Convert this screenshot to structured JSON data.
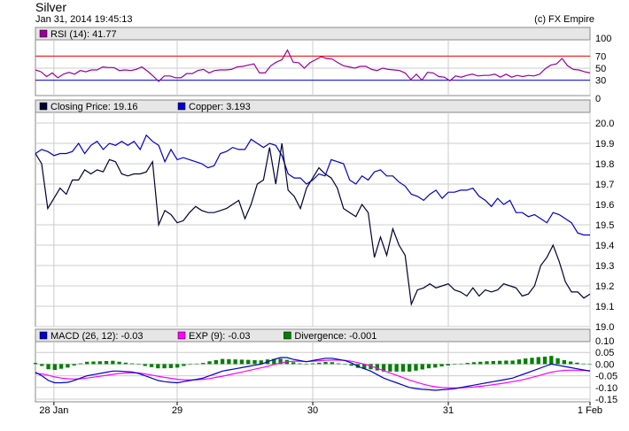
{
  "header": {
    "title": "Silver",
    "timestamp": "Jan 31, 2014 19:45:13",
    "credit": "(c) FX Empire"
  },
  "colors": {
    "rsi": "#990099",
    "closing": "#000033",
    "copper": "#0000cc",
    "macd": "#0000cc",
    "exp": "#ff00ff",
    "divergence": "#008000",
    "rsi_upper": "#ff0000",
    "rsi_lower": "#0000ff",
    "panel_header": "#e6e6e6",
    "grid": "#cccccc"
  },
  "chart_data": [
    {
      "type": "line",
      "panel": "rsi",
      "legend": [
        {
          "label": "RSI (14): 41.77",
          "color": "#990099"
        }
      ],
      "ylim": [
        0,
        100
      ],
      "yticks": [
        "100",
        "70",
        "50",
        "30",
        "0"
      ],
      "ytick_values": [
        100,
        70,
        50,
        30,
        0
      ],
      "reference_lines": [
        70,
        30
      ],
      "series": [
        {
          "values": [
            47,
            44,
            36,
            42,
            34,
            40,
            43,
            40,
            46,
            44,
            47,
            47,
            52,
            51,
            51,
            46,
            47,
            46,
            48,
            52,
            45,
            37,
            28,
            37,
            37,
            34,
            34,
            41,
            41,
            46,
            48,
            42,
            46,
            47,
            47,
            48,
            52,
            53,
            55,
            57,
            42,
            42,
            54,
            60,
            64,
            80,
            60,
            59,
            50,
            59,
            64,
            69,
            66,
            65,
            59,
            54,
            52,
            50,
            53,
            53,
            48,
            46,
            50,
            48,
            47,
            46,
            42,
            31,
            40,
            30,
            43,
            42,
            36,
            35,
            29,
            37,
            35,
            38,
            40,
            37,
            38,
            38,
            40,
            35,
            40,
            35,
            38,
            36,
            38,
            37,
            40,
            49,
            55,
            57,
            66,
            54,
            48,
            47,
            44,
            42
          ]
        }
      ]
    },
    {
      "type": "line",
      "panel": "price",
      "legend": [
        {
          "label": "Closing Price: 19.16",
          "color": "#000033"
        },
        {
          "label": "Copper: 3.193",
          "color": "#0000cc"
        }
      ],
      "ylim": [
        19.0,
        20.0
      ],
      "yticks": [
        "20.0",
        "19.9",
        "19.8",
        "19.7",
        "19.6",
        "19.5",
        "19.4",
        "19.3",
        "19.2",
        "19.1",
        "19.0"
      ],
      "ytick_values": [
        20.0,
        19.9,
        19.8,
        19.7,
        19.6,
        19.5,
        19.4,
        19.3,
        19.2,
        19.1,
        19.0
      ],
      "series": [
        {
          "name": "Closing Price",
          "values": [
            19.85,
            19.8,
            19.58,
            19.63,
            19.68,
            19.65,
            19.72,
            19.72,
            19.77,
            19.75,
            19.77,
            19.76,
            19.82,
            19.81,
            19.75,
            19.74,
            19.75,
            19.75,
            19.76,
            19.81,
            19.5,
            19.57,
            19.55,
            19.51,
            19.52,
            19.56,
            19.59,
            19.57,
            19.56,
            19.56,
            19.57,
            19.58,
            19.6,
            19.62,
            19.53,
            19.6,
            19.7,
            19.72,
            19.88,
            19.7,
            19.9,
            19.67,
            19.64,
            19.58,
            19.68,
            19.73,
            19.78,
            19.75,
            19.73,
            19.68,
            19.58,
            19.56,
            19.54,
            19.6,
            19.56,
            19.34,
            19.44,
            19.35,
            19.48,
            19.4,
            19.35,
            19.11,
            19.18,
            19.19,
            19.21,
            19.19,
            19.2,
            19.21,
            19.18,
            19.17,
            19.15,
            19.19,
            19.15,
            19.18,
            19.17,
            19.18,
            19.21,
            19.2,
            19.19,
            19.15,
            19.16,
            19.2,
            19.3,
            19.34,
            19.4,
            19.32,
            19.22,
            19.17,
            19.17,
            19.14,
            19.16
          ]
        },
        {
          "name": "Copper",
          "values": [
            19.85,
            19.87,
            19.86,
            19.84,
            19.85,
            19.85,
            19.86,
            19.9,
            19.85,
            19.89,
            19.91,
            19.87,
            19.9,
            19.89,
            19.91,
            19.89,
            19.91,
            19.87,
            19.94,
            19.91,
            19.89,
            19.81,
            19.87,
            19.82,
            19.83,
            19.82,
            19.81,
            19.8,
            19.78,
            19.79,
            19.85,
            19.86,
            19.88,
            19.87,
            19.87,
            19.92,
            19.9,
            19.88,
            19.9,
            19.89,
            19.84,
            19.75,
            19.73,
            19.73,
            19.7,
            19.72,
            19.75,
            19.74,
            19.82,
            19.81,
            19.8,
            19.72,
            19.7,
            19.74,
            19.72,
            19.76,
            19.77,
            19.74,
            19.74,
            19.71,
            19.69,
            19.65,
            19.64,
            19.62,
            19.65,
            19.67,
            19.63,
            19.66,
            19.66,
            19.67,
            19.67,
            19.68,
            19.64,
            19.62,
            19.59,
            19.63,
            19.6,
            19.62,
            19.56,
            19.56,
            19.54,
            19.55,
            19.53,
            19.51,
            19.56,
            19.55,
            19.53,
            19.51,
            19.46,
            19.45,
            19.45
          ]
        }
      ]
    },
    {
      "type": "line",
      "panel": "macd",
      "legend": [
        {
          "label": "MACD (26, 12): -0.03",
          "color": "#0000cc"
        },
        {
          "label": "EXP (9): -0.03",
          "color": "#ff00ff"
        },
        {
          "label": "Divergence: -0.001",
          "color": "#008000"
        }
      ],
      "ylim": [
        -0.15,
        0.1
      ],
      "yticks": [
        "0.10",
        "0.05",
        "0.00",
        "-0.05",
        "-0.10",
        "-0.15"
      ],
      "ytick_values": [
        0.1,
        0.05,
        0.0,
        -0.05,
        -0.1,
        -0.15
      ],
      "x_tick_labels": [
        "28 Jan",
        "29",
        "30",
        "31",
        "1 Feb"
      ],
      "x_tick_index": [
        3,
        23,
        45,
        67,
        90
      ],
      "series": [
        {
          "name": "MACD",
          "values": [
            -0.035,
            -0.05,
            -0.07,
            -0.08,
            -0.08,
            -0.078,
            -0.07,
            -0.06,
            -0.05,
            -0.045,
            -0.04,
            -0.035,
            -0.03,
            -0.03,
            -0.032,
            -0.034,
            -0.04,
            -0.05,
            -0.06,
            -0.07,
            -0.075,
            -0.078,
            -0.08,
            -0.075,
            -0.07,
            -0.065,
            -0.06,
            -0.05,
            -0.04,
            -0.03,
            -0.025,
            -0.02,
            -0.015,
            -0.01,
            -0.005,
            0.0,
            0.01,
            0.02,
            0.028,
            0.028,
            0.02,
            0.015,
            0.01,
            0.015,
            0.02,
            0.025,
            0.025,
            0.02,
            0.015,
            0.005,
            -0.01,
            -0.02,
            -0.03,
            -0.045,
            -0.06,
            -0.07,
            -0.08,
            -0.09,
            -0.1,
            -0.105,
            -0.108,
            -0.11,
            -0.112,
            -0.11,
            -0.108,
            -0.105,
            -0.1,
            -0.095,
            -0.09,
            -0.085,
            -0.08,
            -0.075,
            -0.07,
            -0.065,
            -0.06,
            -0.05,
            -0.04,
            -0.03,
            -0.02,
            -0.01,
            0.0,
            -0.005,
            -0.01,
            -0.015,
            -0.02,
            -0.025,
            -0.03
          ]
        },
        {
          "name": "EXP",
          "values": [
            -0.04,
            -0.042,
            -0.048,
            -0.055,
            -0.06,
            -0.063,
            -0.064,
            -0.063,
            -0.06,
            -0.056,
            -0.052,
            -0.048,
            -0.044,
            -0.04,
            -0.038,
            -0.037,
            -0.038,
            -0.042,
            -0.047,
            -0.052,
            -0.057,
            -0.061,
            -0.065,
            -0.067,
            -0.068,
            -0.067,
            -0.065,
            -0.062,
            -0.057,
            -0.052,
            -0.046,
            -0.04,
            -0.034,
            -0.028,
            -0.022,
            -0.016,
            -0.01,
            -0.002,
            0.005,
            0.01,
            0.012,
            0.012,
            0.011,
            0.012,
            0.014,
            0.016,
            0.017,
            0.017,
            0.016,
            0.012,
            0.006,
            0.0,
            -0.008,
            -0.018,
            -0.028,
            -0.038,
            -0.048,
            -0.058,
            -0.068,
            -0.077,
            -0.085,
            -0.092,
            -0.097,
            -0.1,
            -0.102,
            -0.103,
            -0.102,
            -0.1,
            -0.098,
            -0.095,
            -0.092,
            -0.088,
            -0.084,
            -0.08,
            -0.075,
            -0.07,
            -0.064,
            -0.057,
            -0.05,
            -0.042,
            -0.035,
            -0.03,
            -0.027,
            -0.026,
            -0.026,
            -0.027,
            -0.028
          ]
        },
        {
          "name": "Divergence",
          "values": [
            0.005,
            -0.008,
            -0.022,
            -0.025,
            -0.02,
            -0.015,
            -0.006,
            0.003,
            0.01,
            0.011,
            0.012,
            0.013,
            0.014,
            0.01,
            0.006,
            0.003,
            -0.002,
            -0.008,
            -0.013,
            -0.018,
            -0.018,
            -0.017,
            -0.015,
            -0.008,
            -0.002,
            0.002,
            0.005,
            0.012,
            0.017,
            0.022,
            0.021,
            0.02,
            0.019,
            0.018,
            0.017,
            0.016,
            0.02,
            0.022,
            0.023,
            0.018,
            0.008,
            0.003,
            -0.001,
            0.003,
            0.006,
            0.009,
            0.008,
            0.003,
            -0.001,
            -0.007,
            -0.016,
            -0.02,
            -0.022,
            -0.027,
            -0.032,
            -0.032,
            -0.032,
            -0.032,
            -0.032,
            -0.028,
            -0.023,
            -0.018,
            -0.015,
            -0.01,
            -0.006,
            -0.002,
            0.002,
            0.005,
            0.008,
            0.01,
            0.012,
            0.013,
            0.014,
            0.015,
            0.015,
            0.02,
            0.024,
            0.027,
            0.03,
            0.032,
            0.035,
            0.025,
            0.017,
            0.011,
            0.006,
            0.002,
            -0.001
          ]
        }
      ]
    }
  ]
}
